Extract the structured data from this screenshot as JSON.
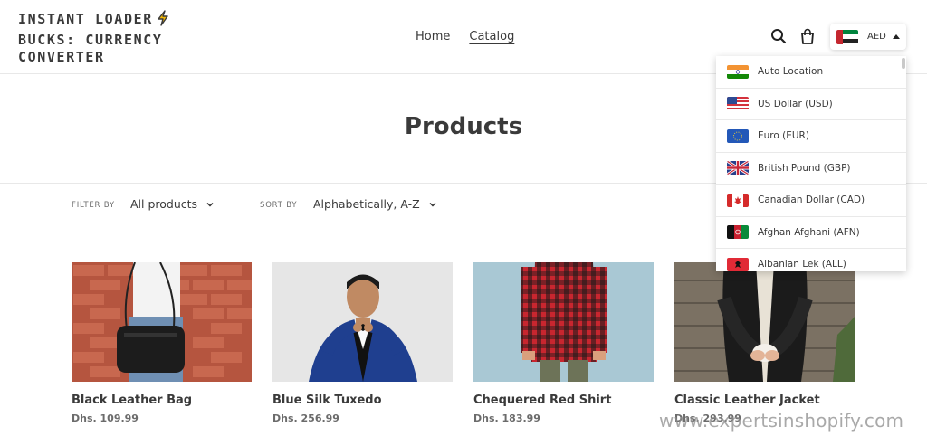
{
  "header": {
    "logo_line1": "INSTANT LOADER",
    "logo_line2": "BUCKS: CURRENCY",
    "logo_line3": "CONVERTER",
    "nav": [
      {
        "label": "Home"
      },
      {
        "label": "Catalog"
      }
    ],
    "currency_code": "AED"
  },
  "page": {
    "title": "Products"
  },
  "filters": {
    "filter_by_label": "FILTER BY",
    "filter_value": "All products",
    "sort_by_label": "SORT BY",
    "sort_value": "Alphabetically, A-Z"
  },
  "products": [
    {
      "name": "Black Leather Bag",
      "price": "Dhs. 109.99"
    },
    {
      "name": "Blue Silk Tuxedo",
      "price": "Dhs. 256.99"
    },
    {
      "name": "Chequered Red Shirt",
      "price": "Dhs. 183.99"
    },
    {
      "name": "Classic Leather Jacket",
      "price": "Dhs. 293.99"
    }
  ],
  "currency_menu": {
    "items": [
      {
        "label": "Auto Location",
        "flag": "india-flag-icon"
      },
      {
        "label": "US Dollar (USD)",
        "flag": "usa-flag-icon"
      },
      {
        "label": "Euro (EUR)",
        "flag": "eu-flag-icon"
      },
      {
        "label": "British Pound (GBP)",
        "flag": "uk-flag-icon"
      },
      {
        "label": "Canadian Dollar (CAD)",
        "flag": "canada-flag-icon"
      },
      {
        "label": "Afghan Afghani (AFN)",
        "flag": "afghanistan-flag-icon"
      },
      {
        "label": "Albanian Lek (ALL)",
        "flag": "albania-flag-icon"
      }
    ]
  },
  "watermark": "www.expertsinshopify.com",
  "colors": {
    "text": "#3a3a3a",
    "muted": "#6b6b6b",
    "border": "#e8e8e8"
  }
}
